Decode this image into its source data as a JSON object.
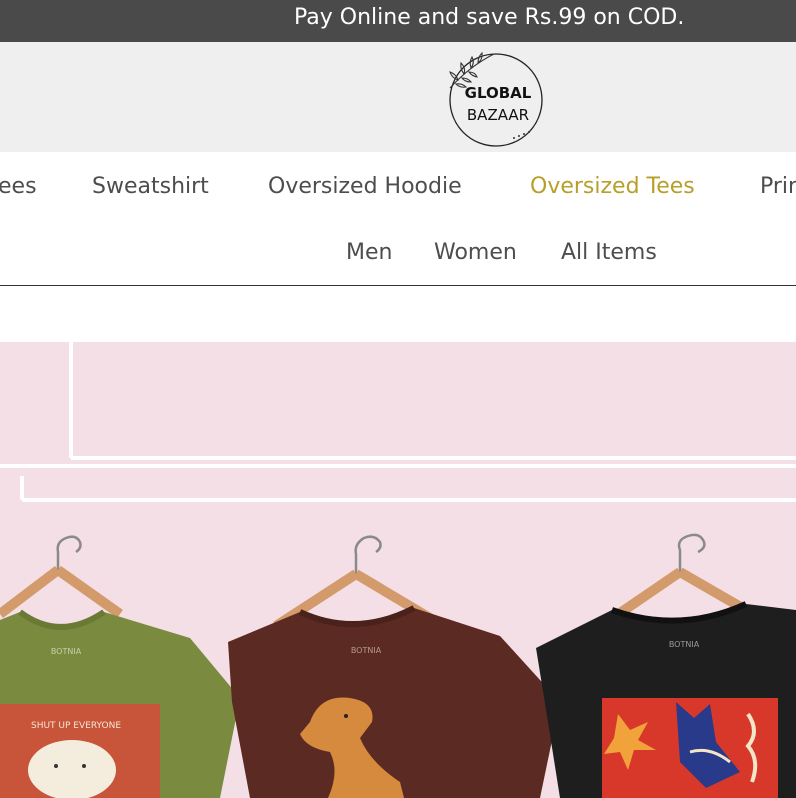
{
  "announcement": {
    "text": "Pay Online and save Rs.99 on COD."
  },
  "logo": {
    "line1": "GLOBAL",
    "line2": "BAZAAR"
  },
  "nav": {
    "primary": [
      {
        "label": "ees"
      },
      {
        "label": "Sweatshirt"
      },
      {
        "label": "Oversized Hoodie"
      },
      {
        "label": "Oversized Tees",
        "active": true
      },
      {
        "label": "Prin"
      }
    ],
    "secondary": [
      {
        "label": "Men"
      },
      {
        "label": "Women"
      },
      {
        "label": "All Items"
      }
    ]
  },
  "hero": {
    "shirts": [
      {
        "brand": "BOTNIA",
        "print_text": "SHUT UP EVERYONE",
        "color": "#7a8b3f"
      },
      {
        "brand": "BOTNIA",
        "color": "#5b2a22"
      },
      {
        "brand": "BOTNIA",
        "color": "#1e1e1e"
      }
    ]
  },
  "colors": {
    "announcement_bg": "#4a4a4a",
    "header_bg": "#efefef",
    "accent": "#b79f2a",
    "hero_bg": "#f5dfe7"
  }
}
